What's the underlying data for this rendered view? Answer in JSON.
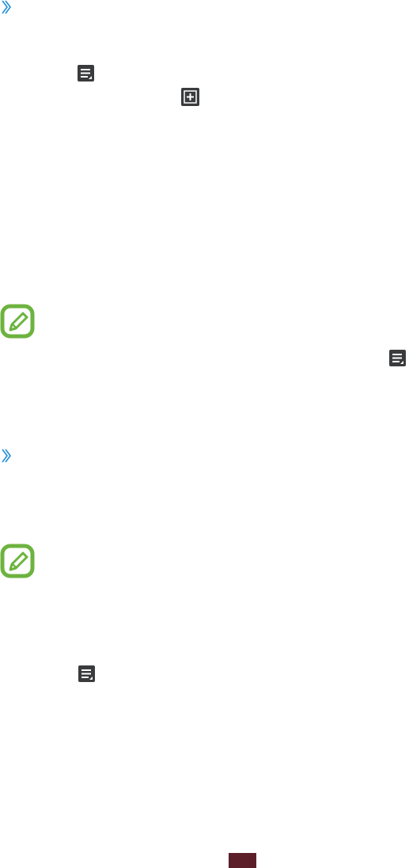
{
  "icons": {
    "section_chevron": "chevron-right-double-icon",
    "menu": "menu-icon",
    "add": "add-box-icon",
    "note": "note-pencil-icon"
  },
  "colors": {
    "chevron": "#1f8fd6",
    "icon_dark": "#3a3b3d",
    "note_green": "#6db33f",
    "page_badge": "#5c1f29"
  },
  "footer": {
    "page_number": ""
  }
}
